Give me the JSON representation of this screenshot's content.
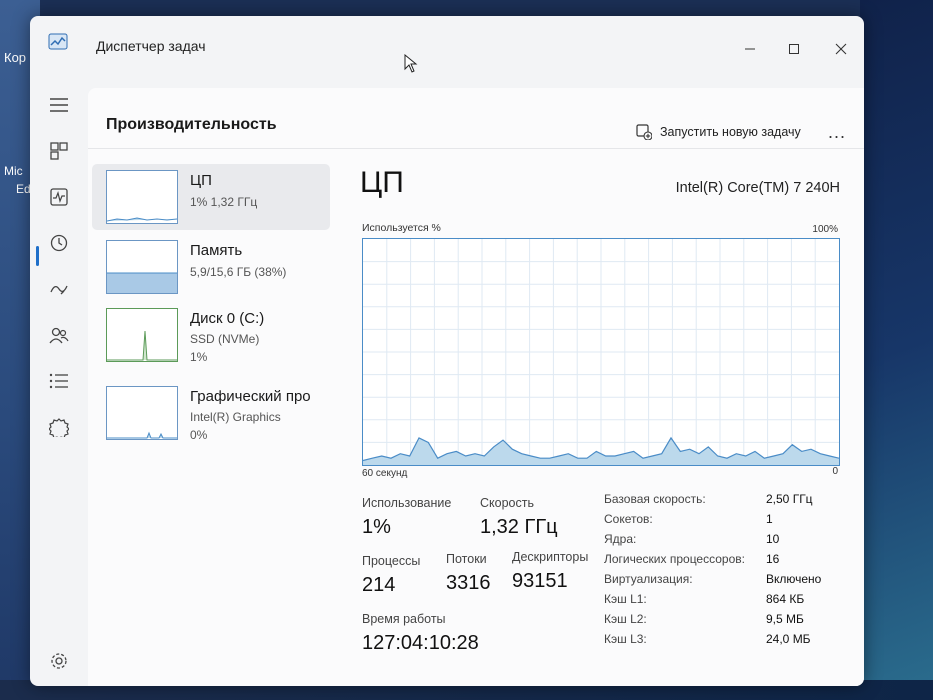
{
  "desktop": {
    "label_top": "Кор",
    "label_mid1": "Mic",
    "label_mid2": "Ed"
  },
  "window": {
    "title": "Диспетчер задач",
    "controls": [
      "minimize",
      "maximize",
      "close"
    ]
  },
  "nav": {
    "items": [
      {
        "icon": "hamburger-menu-icon"
      },
      {
        "icon": "processes-icon"
      },
      {
        "icon": "performance-icon",
        "active": true
      },
      {
        "icon": "app-history-icon"
      },
      {
        "icon": "startup-apps-icon"
      },
      {
        "icon": "users-icon"
      },
      {
        "icon": "details-icon"
      },
      {
        "icon": "services-icon"
      }
    ],
    "settings_icon": "gear-icon"
  },
  "header": {
    "title": "Производительность",
    "run_task_label": "Запустить новую задачу",
    "more_label": "..."
  },
  "resources": [
    {
      "name": "ЦП",
      "line1": "1% 1,32 ГГц",
      "line2": "",
      "active": true
    },
    {
      "name": "Память",
      "line1": "5,9/15,6 ГБ (38%)",
      "line2": ""
    },
    {
      "name": "Диск 0 (C:)",
      "line1": "SSD (NVMe)",
      "line2": "1%"
    },
    {
      "name": "Графический про",
      "line1": "Intel(R) Graphics",
      "line2": "0%"
    }
  ],
  "cpu": {
    "title": "ЦП",
    "model": "Intel(R) Core(TM) 7 240H",
    "graph_label": "Используется %",
    "graph_max": "100%",
    "graph_time": "60 секунд",
    "graph_min": "0",
    "usage_history_percent": [
      2,
      3,
      4,
      3,
      5,
      4,
      12,
      10,
      3,
      5,
      6,
      4,
      5,
      4,
      8,
      11,
      7,
      5,
      4,
      3,
      3,
      4,
      5,
      3,
      3,
      6,
      4,
      4,
      5,
      6,
      3,
      4,
      5,
      12,
      6,
      7,
      5,
      8,
      4,
      3,
      5,
      4,
      6,
      3,
      4,
      5,
      9,
      6,
      7,
      5,
      4,
      3
    ],
    "stats": {
      "usage_label": "Использование",
      "usage_value": "1%",
      "speed_label": "Скорость",
      "speed_value": "1,32 ГГц",
      "processes_label": "Процессы",
      "processes_value": "214",
      "threads_label": "Потоки",
      "threads_value": "3316",
      "handles_label": "Дескрипторы",
      "handles_value": "93151",
      "uptime_label": "Время работы",
      "uptime_value": "127:04:10:28"
    },
    "specs": [
      {
        "key": "Базовая скорость:",
        "value": "2,50 ГГц"
      },
      {
        "key": "Сокетов:",
        "value": "1"
      },
      {
        "key": "Ядра:",
        "value": "10"
      },
      {
        "key": "Логических процессоров:",
        "value": "16"
      },
      {
        "key": "Виртуализация:",
        "value": "Включено"
      },
      {
        "key": "Кэш L1:",
        "value": "864 КБ"
      },
      {
        "key": "Кэш L2:",
        "value": "9,5 МБ"
      },
      {
        "key": "Кэш L3:",
        "value": "24,0 МБ"
      }
    ]
  },
  "colors": {
    "accent": "#1f6fc9",
    "graph_line": "#4a8cc7",
    "graph_fill": "#bcd9ec",
    "memory_fill": "#a9c9e6"
  }
}
